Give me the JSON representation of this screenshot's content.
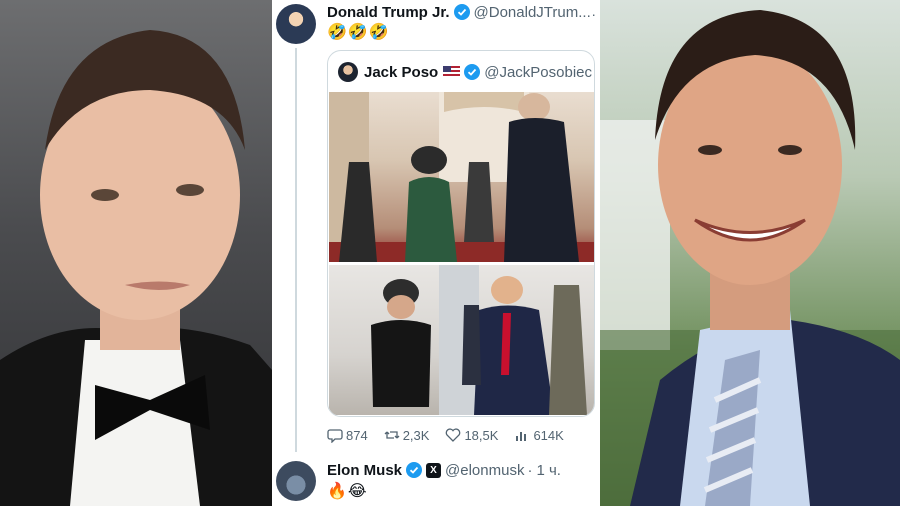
{
  "main_tweet": {
    "display_name": "Donald Trump Jr.",
    "handle": "@DonaldJTrum...",
    "text": "🤣🤣🤣"
  },
  "quoted_tweet": {
    "display_name": "Jack Poso",
    "flag": "🇺🇸",
    "handle": "@JackPosobiec"
  },
  "actions": {
    "replies": "874",
    "reposts": "2,3K",
    "likes": "18,5K",
    "views": "614K"
  },
  "reply_tweet": {
    "display_name": "Elon Musk",
    "handle": "@elonmusk",
    "time": "1 ч.",
    "text": "🔥😂"
  },
  "colors": {
    "verified_blue": "#1d9bf0",
    "text_secondary": "#536471",
    "border": "#cfd9de"
  }
}
